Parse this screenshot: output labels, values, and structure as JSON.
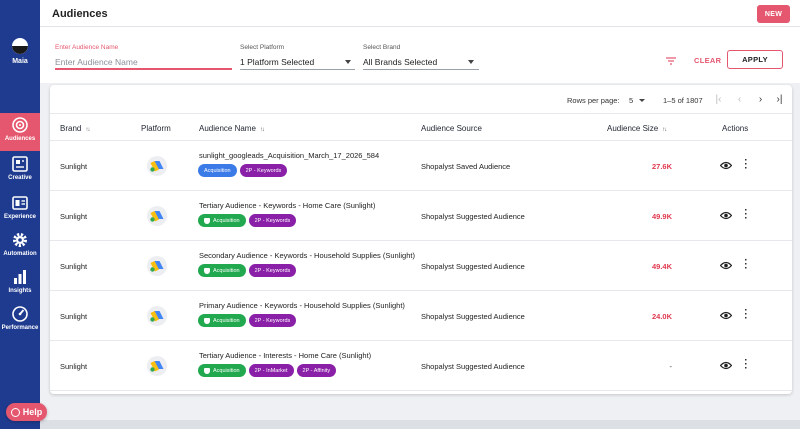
{
  "header": {
    "title": "Audiences",
    "new_label": "NEW"
  },
  "sidebar": {
    "maia_label": "Maia",
    "items": [
      {
        "label": "Audiences",
        "icon": "target-icon",
        "active": true
      },
      {
        "label": "Creative",
        "icon": "creative-icon",
        "active": false
      },
      {
        "label": "Experience",
        "icon": "experience-icon",
        "active": false
      },
      {
        "label": "Automation",
        "icon": "gear-icon",
        "active": false
      },
      {
        "label": "Insights",
        "icon": "bar-chart-icon",
        "active": false
      },
      {
        "label": "Performance",
        "icon": "speedometer-icon",
        "active": false
      }
    ],
    "help_label": "Help"
  },
  "filters": {
    "name_label": "Enter Audience Name",
    "name_placeholder": "Enter Audience Name",
    "platform_label": "Select Platform",
    "platform_value": "1 Platform Selected",
    "brand_label": "Select Brand",
    "brand_value": "All Brands Selected",
    "clear_label": "CLEAR",
    "apply_label": "APPLY"
  },
  "pagination": {
    "rows_label": "Rows per page:",
    "rows_value": "5",
    "range": "1–5 of 1807"
  },
  "table": {
    "headers": {
      "brand": "Brand",
      "platform": "Platform",
      "name": "Audience Name",
      "source": "Audience Source",
      "size": "Audience Size",
      "actions": "Actions"
    },
    "rows": [
      {
        "brand": "Sunlight",
        "name": "sunlight_googleads_Acquisition_March_17_2026_584",
        "chips": [
          {
            "label": "Acquisition",
            "color": "blue",
            "icon": false
          },
          {
            "label": "2P - Keywords",
            "color": "purple"
          }
        ],
        "source": "Shopalyst Saved Audience",
        "size": "27.6K"
      },
      {
        "brand": "Sunlight",
        "name": "Tertiary Audience - Keywords - Home Care (Sunlight)",
        "chips": [
          {
            "label": "Acquisition",
            "color": "green",
            "icon": true
          },
          {
            "label": "2P - Keywords",
            "color": "purple"
          }
        ],
        "source": "Shopalyst Suggested Audience",
        "size": "49.9K"
      },
      {
        "brand": "Sunlight",
        "name": "Secondary Audience - Keywords - Household Supplies (Sunlight)",
        "chips": [
          {
            "label": "Acquisition",
            "color": "green",
            "icon": true
          },
          {
            "label": "2P - Keywords",
            "color": "purple"
          }
        ],
        "source": "Shopalyst Suggested Audience",
        "size": "49.4K"
      },
      {
        "brand": "Sunlight",
        "name": "Primary Audience - Keywords - Household Supplies (Sunlight)",
        "chips": [
          {
            "label": "Acquisition",
            "color": "green",
            "icon": true
          },
          {
            "label": "2P - Keywords",
            "color": "purple"
          }
        ],
        "source": "Shopalyst Suggested Audience",
        "size": "24.0K"
      },
      {
        "brand": "Sunlight",
        "name": "Tertiary Audience - Interests - Home Care (Sunlight)",
        "chips": [
          {
            "label": "Acquisition",
            "color": "green",
            "icon": true
          },
          {
            "label": "2P - InMarket",
            "color": "purple"
          },
          {
            "label": "2P - Affinity",
            "color": "purple"
          }
        ],
        "source": "Shopalyst Suggested Audience",
        "size": "-"
      }
    ]
  },
  "colors": {
    "sidebar": "#1f3b8f",
    "accent": "#e5576f",
    "size_value": "#e03a4f",
    "chip_blue": "#3b7be8",
    "chip_green": "#22a94f",
    "chip_purple": "#8a1fa8"
  }
}
